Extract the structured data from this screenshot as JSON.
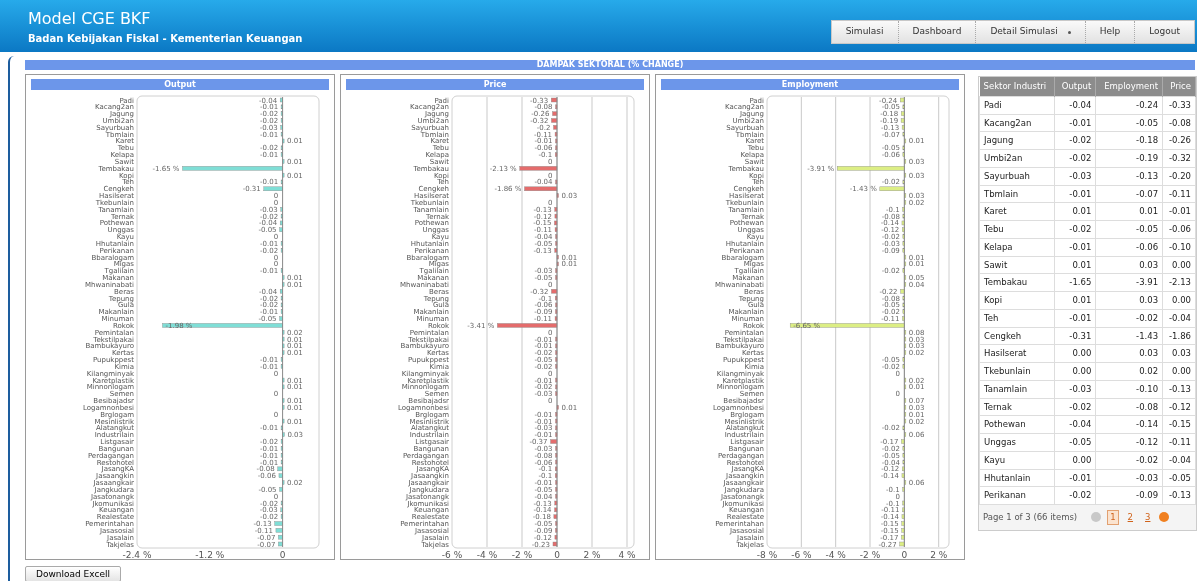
{
  "header": {
    "title": "Model CGE BKF",
    "subtitle": "Badan Kebijakan Fiskal - Kementerian Keuangan"
  },
  "nav": [
    {
      "label": "Simulasi",
      "dropdown": false
    },
    {
      "label": "Dashboard",
      "dropdown": false
    },
    {
      "label": "Detail Simulasi",
      "dropdown": true
    },
    {
      "label": "Help",
      "dropdown": false
    },
    {
      "label": "Logout",
      "dropdown": false
    }
  ],
  "section_title": "DAMPAK SEKTORAL (% CHANGE)",
  "charts": [
    {
      "chart_data": {
        "type": "bar",
        "orientation": "horizontal",
        "categories": [
          "Padi",
          "Kacang2an",
          "Jagung",
          "Umbi2an",
          "Sayurbuah",
          "Tbmlain",
          "Karet",
          "Tebu",
          "Kelapa",
          "Sawit",
          "Tembakau",
          "Kopi",
          "Teh",
          "Cengkeh",
          "Hasilserat",
          "Tkebunlain",
          "Tanamlain",
          "Ternak",
          "Pothewan",
          "Unggas",
          "Kayu",
          "Hhutanlain",
          "Perikanan",
          "Bbaralogam",
          "Migas",
          "Tgalilain",
          "Makanan",
          "Mhwaninabati",
          "Beras",
          "Tepung",
          "Gula",
          "Makanlain",
          "Minuman",
          "Rokok",
          "Pemintalan",
          "Tekstilpakai",
          "Bambukayuro",
          "Kertas",
          "Pupukppest",
          "Kimia",
          "Kilangminyak",
          "Karetplastik",
          "Minnonlogam",
          "Semen",
          "Besibajadsr",
          "Logamnonbesi",
          "Brglogam",
          "Mesinlistrik",
          "Alatangkut",
          "Industrilain",
          "Listgasair",
          "Bangunan",
          "Perdagangan",
          "Restohotel",
          "JasangKA",
          "Jasaangkin",
          "Jasaangkair",
          "Jangkudara",
          "Jasatonangk",
          "Jkomunikasi",
          "Keuangan",
          "Realestate",
          "Pemerintahan",
          "Jasasosial",
          "Jasalain",
          "Takjelas"
        ],
        "series": [
          {
            "name": "Output",
            "color": "#7fded6",
            "values": [
              -0.04,
              -0.01,
              -0.02,
              -0.02,
              -0.03,
              -0.01,
              0.01,
              -0.02,
              -0.01,
              0.01,
              -1.65,
              0.01,
              -0.01,
              -0.31,
              0,
              0,
              -0.03,
              -0.02,
              -0.04,
              -0.05,
              0,
              -0.01,
              -0.02,
              0,
              0,
              -0.01,
              0.01,
              0.01,
              -0.04,
              -0.02,
              -0.02,
              -0.01,
              -0.05,
              -1.98,
              0.02,
              0.01,
              0.01,
              0.01,
              -0.01,
              -0.01,
              0,
              0.01,
              0.01,
              0,
              0.01,
              0.01,
              0,
              0.01,
              -0.01,
              0.03,
              -0.02,
              -0.01,
              -0.01,
              -0.01,
              -0.08,
              -0.06,
              0.02,
              -0.05,
              0,
              -0.02,
              -0.03,
              -0.02,
              -0.13,
              -0.11,
              -0.07,
              -0.07
            ]
          }
        ],
        "value_labels": [
          "-0.04",
          "-0.01",
          "-0.02",
          "-0.02",
          "-0.03",
          "-0.01",
          "0.01",
          "-0.02",
          "-0.01",
          "0.01",
          "-1.65 %",
          "0.01",
          "-0.01",
          "-0.31",
          "0",
          "0",
          "-0.03",
          "-0.02",
          "-0.04",
          "-0.05",
          "0",
          "-0.01",
          "-0.02",
          "0",
          "0",
          "-0.01",
          "0.01",
          "0.01",
          "-0.04",
          "-0.02",
          "-0.02",
          "-0.01",
          "-0.05",
          "-1.98 %",
          "0.02",
          "0.01",
          "0.01",
          "0.01",
          "-0.01",
          "-0.01",
          "0",
          "0.01",
          "0.01",
          "0",
          "0.01",
          "0.01",
          "0",
          "0.01",
          "-0.01",
          "0.03",
          "-0.02",
          "-0.01",
          "-0.01",
          "-0.01",
          "-0.08",
          "-0.06",
          "0.02",
          "-0.05",
          "0",
          "-0.02",
          "-0.03",
          "-0.02",
          "-0.13",
          "-0.11",
          "-0.07",
          "-0.07"
        ],
        "xlim": [
          -2.4,
          0.6
        ],
        "xticks": [
          {
            "value": -2.4,
            "label": "-2.4 %"
          },
          {
            "value": -1.2,
            "label": "-1.2 %"
          },
          {
            "value": 0,
            "label": "0"
          }
        ]
      }
    },
    {
      "chart_data": {
        "type": "bar",
        "orientation": "horizontal",
        "grid": true,
        "categories": [
          "Padi",
          "Kacang2an",
          "Jagung",
          "Umbi2an",
          "Sayurbuah",
          "Tbmlain",
          "Karet",
          "Tebu",
          "Kelapa",
          "Sawit",
          "Tembakau",
          "Kopi",
          "Teh",
          "Cengkeh",
          "Hasilserat",
          "Tkebunlain",
          "Tanamlain",
          "Ternak",
          "Pothewan",
          "Unggas",
          "Kayu",
          "Hhutanlain",
          "Perikanan",
          "Bbaralogam",
          "Migas",
          "Tgalilain",
          "Makanan",
          "Mhwaninabati",
          "Beras",
          "Tepung",
          "Gula",
          "Makanlain",
          "Minuman",
          "Rokok",
          "Pemintalan",
          "Tekstilpakai",
          "Bambukayuro",
          "Kertas",
          "Pupukppest",
          "Kimia",
          "Kilangminyak",
          "Karetplastik",
          "Minnonlogam",
          "Semen",
          "Besibajadsr",
          "Logamnonbesi",
          "Brglogam",
          "Mesinlistrik",
          "Alatangkut",
          "Industrilain",
          "Listgasair",
          "Bangunan",
          "Perdagangan",
          "Restohotel",
          "JasangKA",
          "Jasaangkin",
          "Jasaangkair",
          "Jangkudara",
          "Jasatonangk",
          "Jkomunikasi",
          "Keuangan",
          "Realestate",
          "Pemerintahan",
          "Jasasosial",
          "Jasalain",
          "Takjelas"
        ],
        "series": [
          {
            "name": "Price",
            "color": "#e46c6c",
            "values": [
              -0.33,
              -0.08,
              -0.26,
              -0.32,
              -0.2,
              -0.11,
              -0.01,
              -0.06,
              -0.1,
              0,
              -2.13,
              0,
              -0.04,
              -1.86,
              0.03,
              0,
              -0.13,
              -0.12,
              -0.15,
              -0.11,
              -0.04,
              -0.05,
              -0.13,
              0.01,
              0.01,
              -0.03,
              -0.05,
              0,
              -0.32,
              -0.1,
              -0.06,
              -0.09,
              -0.11,
              -3.41,
              0,
              -0.01,
              -0.01,
              -0.02,
              -0.05,
              -0.02,
              0,
              -0.01,
              -0.02,
              -0.03,
              0,
              0.01,
              -0.01,
              -0.01,
              -0.03,
              -0.01,
              -0.37,
              -0.03,
              -0.08,
              -0.06,
              -0.1,
              -0.1,
              -0.01,
              -0.05,
              -0.04,
              -0.13,
              -0.14,
              -0.18,
              -0.05,
              -0.09,
              -0.12,
              -0.23
            ]
          }
        ],
        "value_labels": [
          "-0.33",
          "-0.08",
          "-0.26",
          "-0.32",
          "-0.2",
          "-0.11",
          "-0.01",
          "-0.06",
          "-0.1",
          "0",
          "-2.13 %",
          "0",
          "-0.04",
          "-1.86 %",
          "0.03",
          "0",
          "-0.13",
          "-0.12",
          "-0.15",
          "-0.11",
          "-0.04",
          "-0.05",
          "-0.13",
          "0.01",
          "0.01",
          "-0.03",
          "-0.05",
          "0",
          "-0.32",
          "-0.1",
          "-0.06",
          "-0.09",
          "-0.11",
          "-3.41 %",
          "0",
          "-0.01",
          "-0.01",
          "-0.02",
          "-0.05",
          "-0.02",
          "0",
          "-0.01",
          "-0.02",
          "-0.03",
          "0",
          "0.01",
          "-0.01",
          "-0.01",
          "-0.03",
          "-0.01",
          "-0.37",
          "-0.03",
          "-0.08",
          "-0.06",
          "-0.1",
          "-0.1",
          "-0.01",
          "-0.05",
          "-0.04",
          "-0.13",
          "-0.14",
          "-0.18",
          "-0.05",
          "-0.09",
          "-0.12",
          "-0.23"
        ],
        "xlim": [
          -6,
          4.4
        ],
        "xticks": [
          {
            "value": -6,
            "label": "-6 %"
          },
          {
            "value": -4,
            "label": "-4 %"
          },
          {
            "value": -2,
            "label": "-2 %"
          },
          {
            "value": 0,
            "label": "0"
          },
          {
            "value": 2,
            "label": "2 %"
          },
          {
            "value": 4,
            "label": "4 %"
          }
        ]
      }
    },
    {
      "chart_data": {
        "type": "bar",
        "orientation": "horizontal",
        "grid": true,
        "categories": [
          "Padi",
          "Kacang2an",
          "Jagung",
          "Umbi2an",
          "Sayurbuah",
          "Tbmlain",
          "Karet",
          "Tebu",
          "Kelapa",
          "Sawit",
          "Tembakau",
          "Kopi",
          "Teh",
          "Cengkeh",
          "Hasilserat",
          "Tkebunlain",
          "Tanamlain",
          "Ternak",
          "Pothewan",
          "Unggas",
          "Kayu",
          "Hhutanlain",
          "Perikanan",
          "Bbaralogam",
          "Migas",
          "Tgalilain",
          "Makanan",
          "Mhwaninabati",
          "Beras",
          "Tepung",
          "Gula",
          "Makanlain",
          "Minuman",
          "Rokok",
          "Pemintalan",
          "Tekstilpakai",
          "Bambukayuro",
          "Kertas",
          "Pupukppest",
          "Kimia",
          "Kilangminyak",
          "Karetplastik",
          "Minnonlogam",
          "Semen",
          "Besibajadsr",
          "Logamnonbesi",
          "Brglogam",
          "Mesinlistrik",
          "Alatangkut",
          "Industrilain",
          "Listgasair",
          "Bangunan",
          "Perdagangan",
          "Restohotel",
          "JasangKA",
          "Jasaangkin",
          "Jasaangkair",
          "Jangkudara",
          "Jasatonangk",
          "Jkomunikasi",
          "Keuangan",
          "Realestate",
          "Pemerintahan",
          "Jasasosial",
          "Jasalain",
          "Takjelas"
        ],
        "series": [
          {
            "name": "Employment",
            "color": "#dcee84",
            "values": [
              -0.24,
              -0.05,
              -0.18,
              -0.19,
              -0.13,
              -0.07,
              0.01,
              -0.05,
              -0.06,
              0.03,
              -3.91,
              0.03,
              -0.02,
              -1.43,
              0.03,
              0.02,
              -0.1,
              -0.08,
              -0.14,
              -0.12,
              -0.02,
              -0.03,
              -0.09,
              0.01,
              0.01,
              -0.02,
              0.05,
              0.04,
              -0.22,
              -0.08,
              -0.05,
              -0.02,
              -0.11,
              -6.65,
              0.08,
              0.03,
              0.03,
              0.02,
              -0.05,
              -0.02,
              0,
              0.02,
              0.01,
              0,
              0.07,
              0.03,
              0.01,
              0.02,
              -0.02,
              0.06,
              -0.17,
              -0.02,
              -0.05,
              -0.04,
              -0.12,
              -0.14,
              0.06,
              -0.1,
              0,
              -0.1,
              -0.11,
              -0.14,
              -0.15,
              -0.15,
              -0.17,
              -0.27
            ]
          }
        ],
        "value_labels": [
          "-0.24",
          "-0.05",
          "-0.18",
          "-0.19",
          "-0.13",
          "-0.07",
          "0.01",
          "-0.05",
          "-0.06",
          "0.03",
          "-3.91 %",
          "0.03",
          "-0.02",
          "-1.43 %",
          "0.03",
          "0.02",
          "-0.1",
          "-0.08",
          "-0.14",
          "-0.12",
          "-0.02",
          "-0.03",
          "-0.09",
          "0.01",
          "0.01",
          "-0.02",
          "0.05",
          "0.04",
          "-0.22",
          "-0.08",
          "-0.05",
          "-0.02",
          "-0.11",
          "-6.65 %",
          "0.08",
          "0.03",
          "0.03",
          "0.02",
          "-0.05",
          "-0.02",
          "0",
          "0.02",
          "0.01",
          "0",
          "0.07",
          "0.03",
          "0.01",
          "0.02",
          "-0.02",
          "0.06",
          "-0.17",
          "-0.02",
          "-0.05",
          "-0.04",
          "-0.12",
          "-0.14",
          "0.06",
          "-0.1",
          "0",
          "-0.1",
          "-0.11",
          "-0.14",
          "-0.15",
          "-0.15",
          "-0.17",
          "-0.27"
        ],
        "xlim": [
          -8,
          2.6
        ],
        "xticks": [
          {
            "value": -8,
            "label": "-8 %"
          },
          {
            "value": -6,
            "label": "-6 %"
          },
          {
            "value": -4,
            "label": "-4 %"
          },
          {
            "value": -2,
            "label": "-2 %"
          },
          {
            "value": 0,
            "label": "0"
          },
          {
            "value": 2,
            "label": "2 %"
          }
        ]
      }
    }
  ],
  "table": {
    "columns": [
      "Sektor Industri",
      "Output",
      "Employment",
      "Price"
    ],
    "rows": [
      [
        "Padi",
        "-0.04",
        "-0.24",
        "-0.33"
      ],
      [
        "Kacang2an",
        "-0.01",
        "-0.05",
        "-0.08"
      ],
      [
        "Jagung",
        "-0.02",
        "-0.18",
        "-0.26"
      ],
      [
        "Umbi2an",
        "-0.02",
        "-0.19",
        "-0.32"
      ],
      [
        "Sayurbuah",
        "-0.03",
        "-0.13",
        "-0.20"
      ],
      [
        "Tbmlain",
        "-0.01",
        "-0.07",
        "-0.11"
      ],
      [
        "Karet",
        "0.01",
        "0.01",
        "-0.01"
      ],
      [
        "Tebu",
        "-0.02",
        "-0.05",
        "-0.06"
      ],
      [
        "Kelapa",
        "-0.01",
        "-0.06",
        "-0.10"
      ],
      [
        "Sawit",
        "0.01",
        "0.03",
        "0.00"
      ],
      [
        "Tembakau",
        "-1.65",
        "-3.91",
        "-2.13"
      ],
      [
        "Kopi",
        "0.01",
        "0.03",
        "0.00"
      ],
      [
        "Teh",
        "-0.01",
        "-0.02",
        "-0.04"
      ],
      [
        "Cengkeh",
        "-0.31",
        "-1.43",
        "-1.86"
      ],
      [
        "Hasilserat",
        "0.00",
        "0.03",
        "0.03"
      ],
      [
        "Tkebunlain",
        "0.00",
        "0.02",
        "0.00"
      ],
      [
        "Tanamlain",
        "-0.03",
        "-0.10",
        "-0.13"
      ],
      [
        "Ternak",
        "-0.02",
        "-0.08",
        "-0.12"
      ],
      [
        "Pothewan",
        "-0.04",
        "-0.14",
        "-0.15"
      ],
      [
        "Unggas",
        "-0.05",
        "-0.12",
        "-0.11"
      ],
      [
        "Kayu",
        "0.00",
        "-0.02",
        "-0.04"
      ],
      [
        "Hhutanlain",
        "-0.01",
        "-0.03",
        "-0.05"
      ],
      [
        "Perikanan",
        "-0.02",
        "-0.09",
        "-0.13"
      ]
    ]
  },
  "pager": {
    "summary": "Page 1 of 3 (66 items)",
    "prev_disabled": true,
    "next_disabled": false,
    "pages": [
      {
        "label": "1",
        "selected": true
      },
      {
        "label": "2",
        "selected": false
      },
      {
        "label": "3",
        "selected": false
      }
    ]
  },
  "download_button": "Download Excell"
}
